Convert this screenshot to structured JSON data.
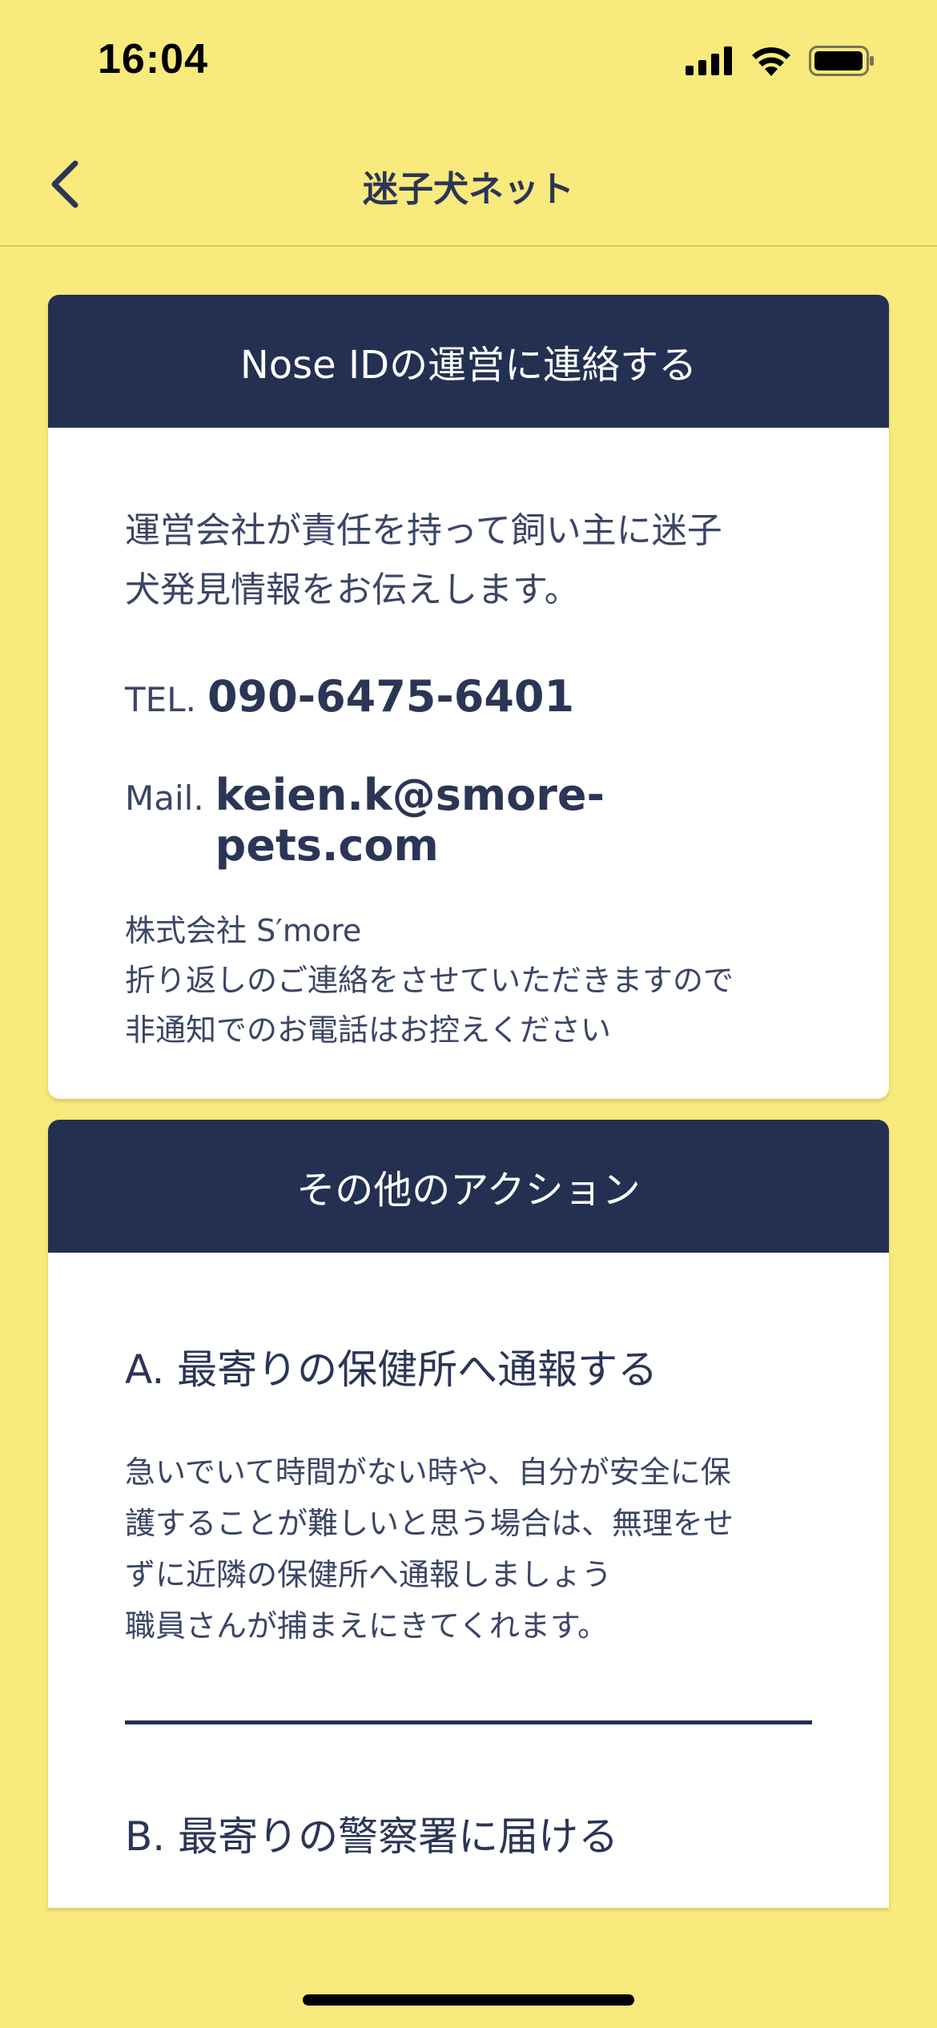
{
  "status": {
    "time": "16:04",
    "icons": [
      "cellular-signal-icon",
      "wifi-icon",
      "battery-icon"
    ]
  },
  "nav": {
    "title": "迷子犬ネット",
    "back_icon": "chevron-left-icon"
  },
  "contact_card": {
    "header": "Nose IDの運営に連絡する",
    "description_lines": [
      "運営会社が責任を持って飼い主に迷子",
      "犬発見情報をお伝えします。"
    ],
    "tel_label": "TEL.",
    "tel_value": "090-6475-6401",
    "mail_label": "Mail.",
    "mail_value": "keien.k@smore-pets.com",
    "company": "株式会社 S′more",
    "note_lines": [
      "折り返しのご連絡をさせていただきますので",
      "非通知でのお電話はお控えください"
    ]
  },
  "actions_card": {
    "header": "その他のアクション",
    "action_a": {
      "title": "A. 最寄りの保健所へ通報する",
      "description_lines": [
        "急いでいて時間がない時や、自分が安全に保",
        "護することが難しいと思う場合は、無理をせ",
        "ずに近隣の保健所へ通報しましょう",
        "職員さんが捕まえにきてくれます。"
      ]
    },
    "action_b": {
      "title": "B. 最寄りの警察署に届ける"
    }
  },
  "colors": {
    "background": "#f8ea7c",
    "header_navy": "#233052",
    "text": "#2b3556",
    "card": "#ffffff"
  }
}
